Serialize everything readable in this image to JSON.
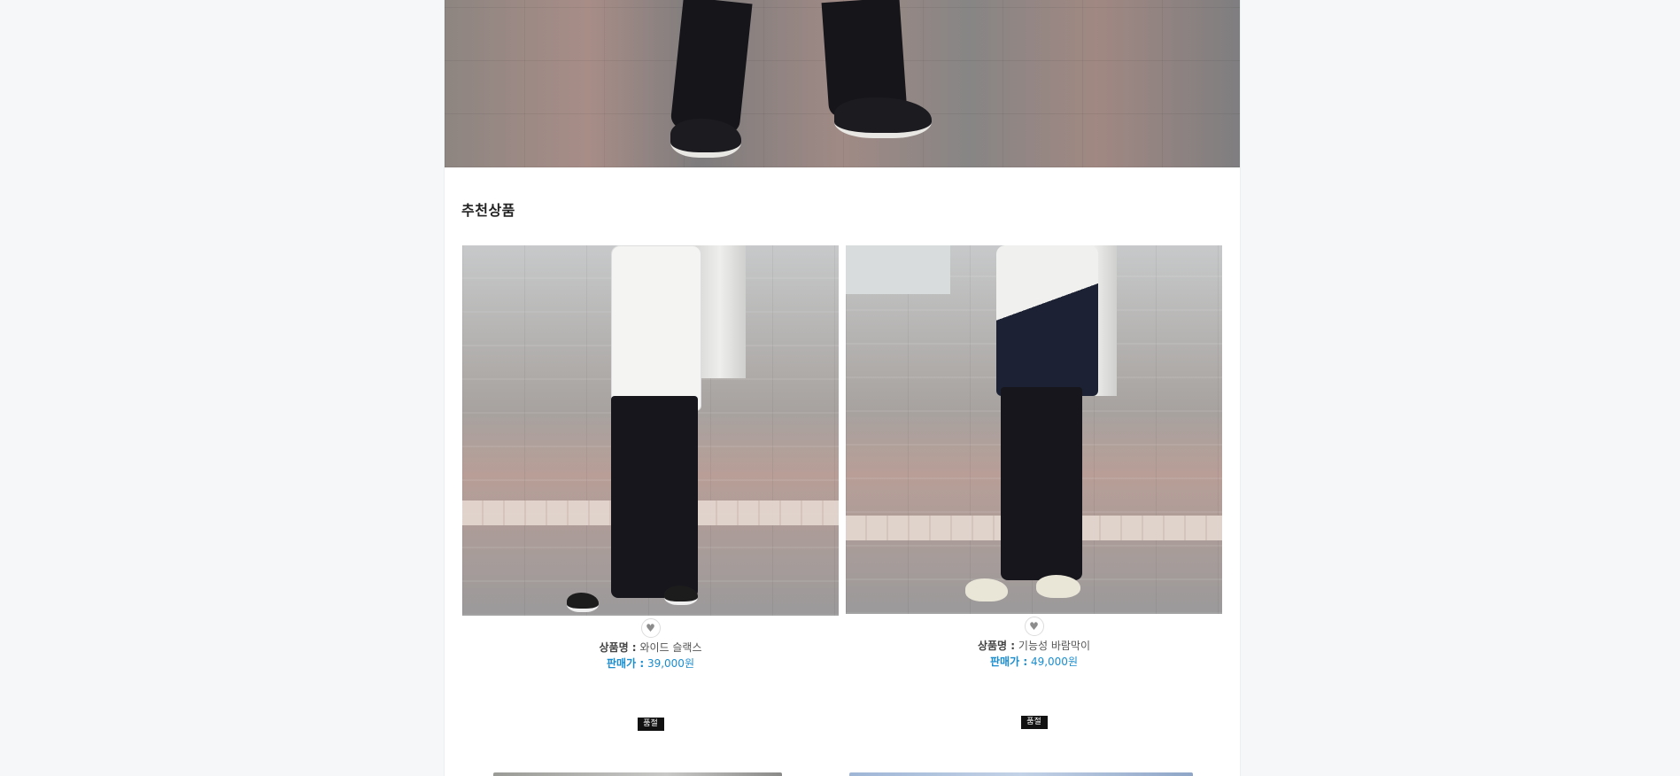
{
  "section": {
    "title": "추천상품"
  },
  "products": [
    {
      "name_label": "상품명 :",
      "name": "와이드 슬랙스",
      "price_label": "판매가 :",
      "price": "39,000원",
      "badge": "품절",
      "wish_icon": "heart-icon"
    },
    {
      "name_label": "상품명 :",
      "name": "기능성 바람막이",
      "price_label": "판매가 :",
      "price": "49,000원",
      "badge": "품절",
      "wish_icon": "heart-icon"
    }
  ],
  "colors": {
    "page_background": "#f5f7f9",
    "content_background": "#ffffff",
    "price_accent": "#1a8dcf",
    "soldout_badge": "#111111"
  }
}
